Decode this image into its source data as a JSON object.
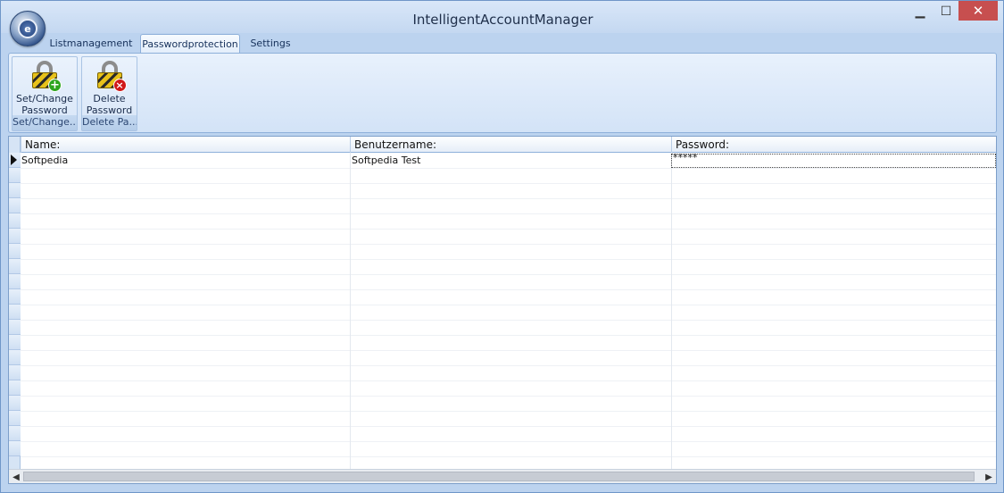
{
  "window": {
    "title": "IntelligentAccountManager",
    "controls": {
      "minimize": "▁",
      "maximize": "☐",
      "close": "✕"
    },
    "app_orb_icon": "e-lock-orb-icon",
    "app_orb_glyph": "e"
  },
  "tabs": [
    {
      "label": "Listmanagement",
      "active": false
    },
    {
      "label": "Passwordprotection",
      "active": true
    },
    {
      "label": "Settings",
      "active": false
    }
  ],
  "ribbon": {
    "groups": [
      {
        "button_line1": "Set/Change",
        "button_line2": "Password",
        "group_label": "Set/Change...",
        "icon": "lock-add-icon",
        "badge": "+"
      },
      {
        "button_line1": "Delete",
        "button_line2": "Password",
        "group_label": "Delete Pa...",
        "icon": "lock-delete-icon",
        "badge": "×"
      }
    ]
  },
  "grid": {
    "columns": [
      "Name:",
      "Benutzername:",
      "Password:"
    ],
    "rows": [
      {
        "name": "Softpedia",
        "username": "Softpedia Test",
        "password": "*****",
        "current": true
      }
    ],
    "empty_rows": 20
  },
  "scrollbar": {
    "left": "◀",
    "right": "▶"
  },
  "colors": {
    "accent": "#c74f4f",
    "ribbon": "#d3e3f7",
    "frame": "#bcd3ef"
  }
}
